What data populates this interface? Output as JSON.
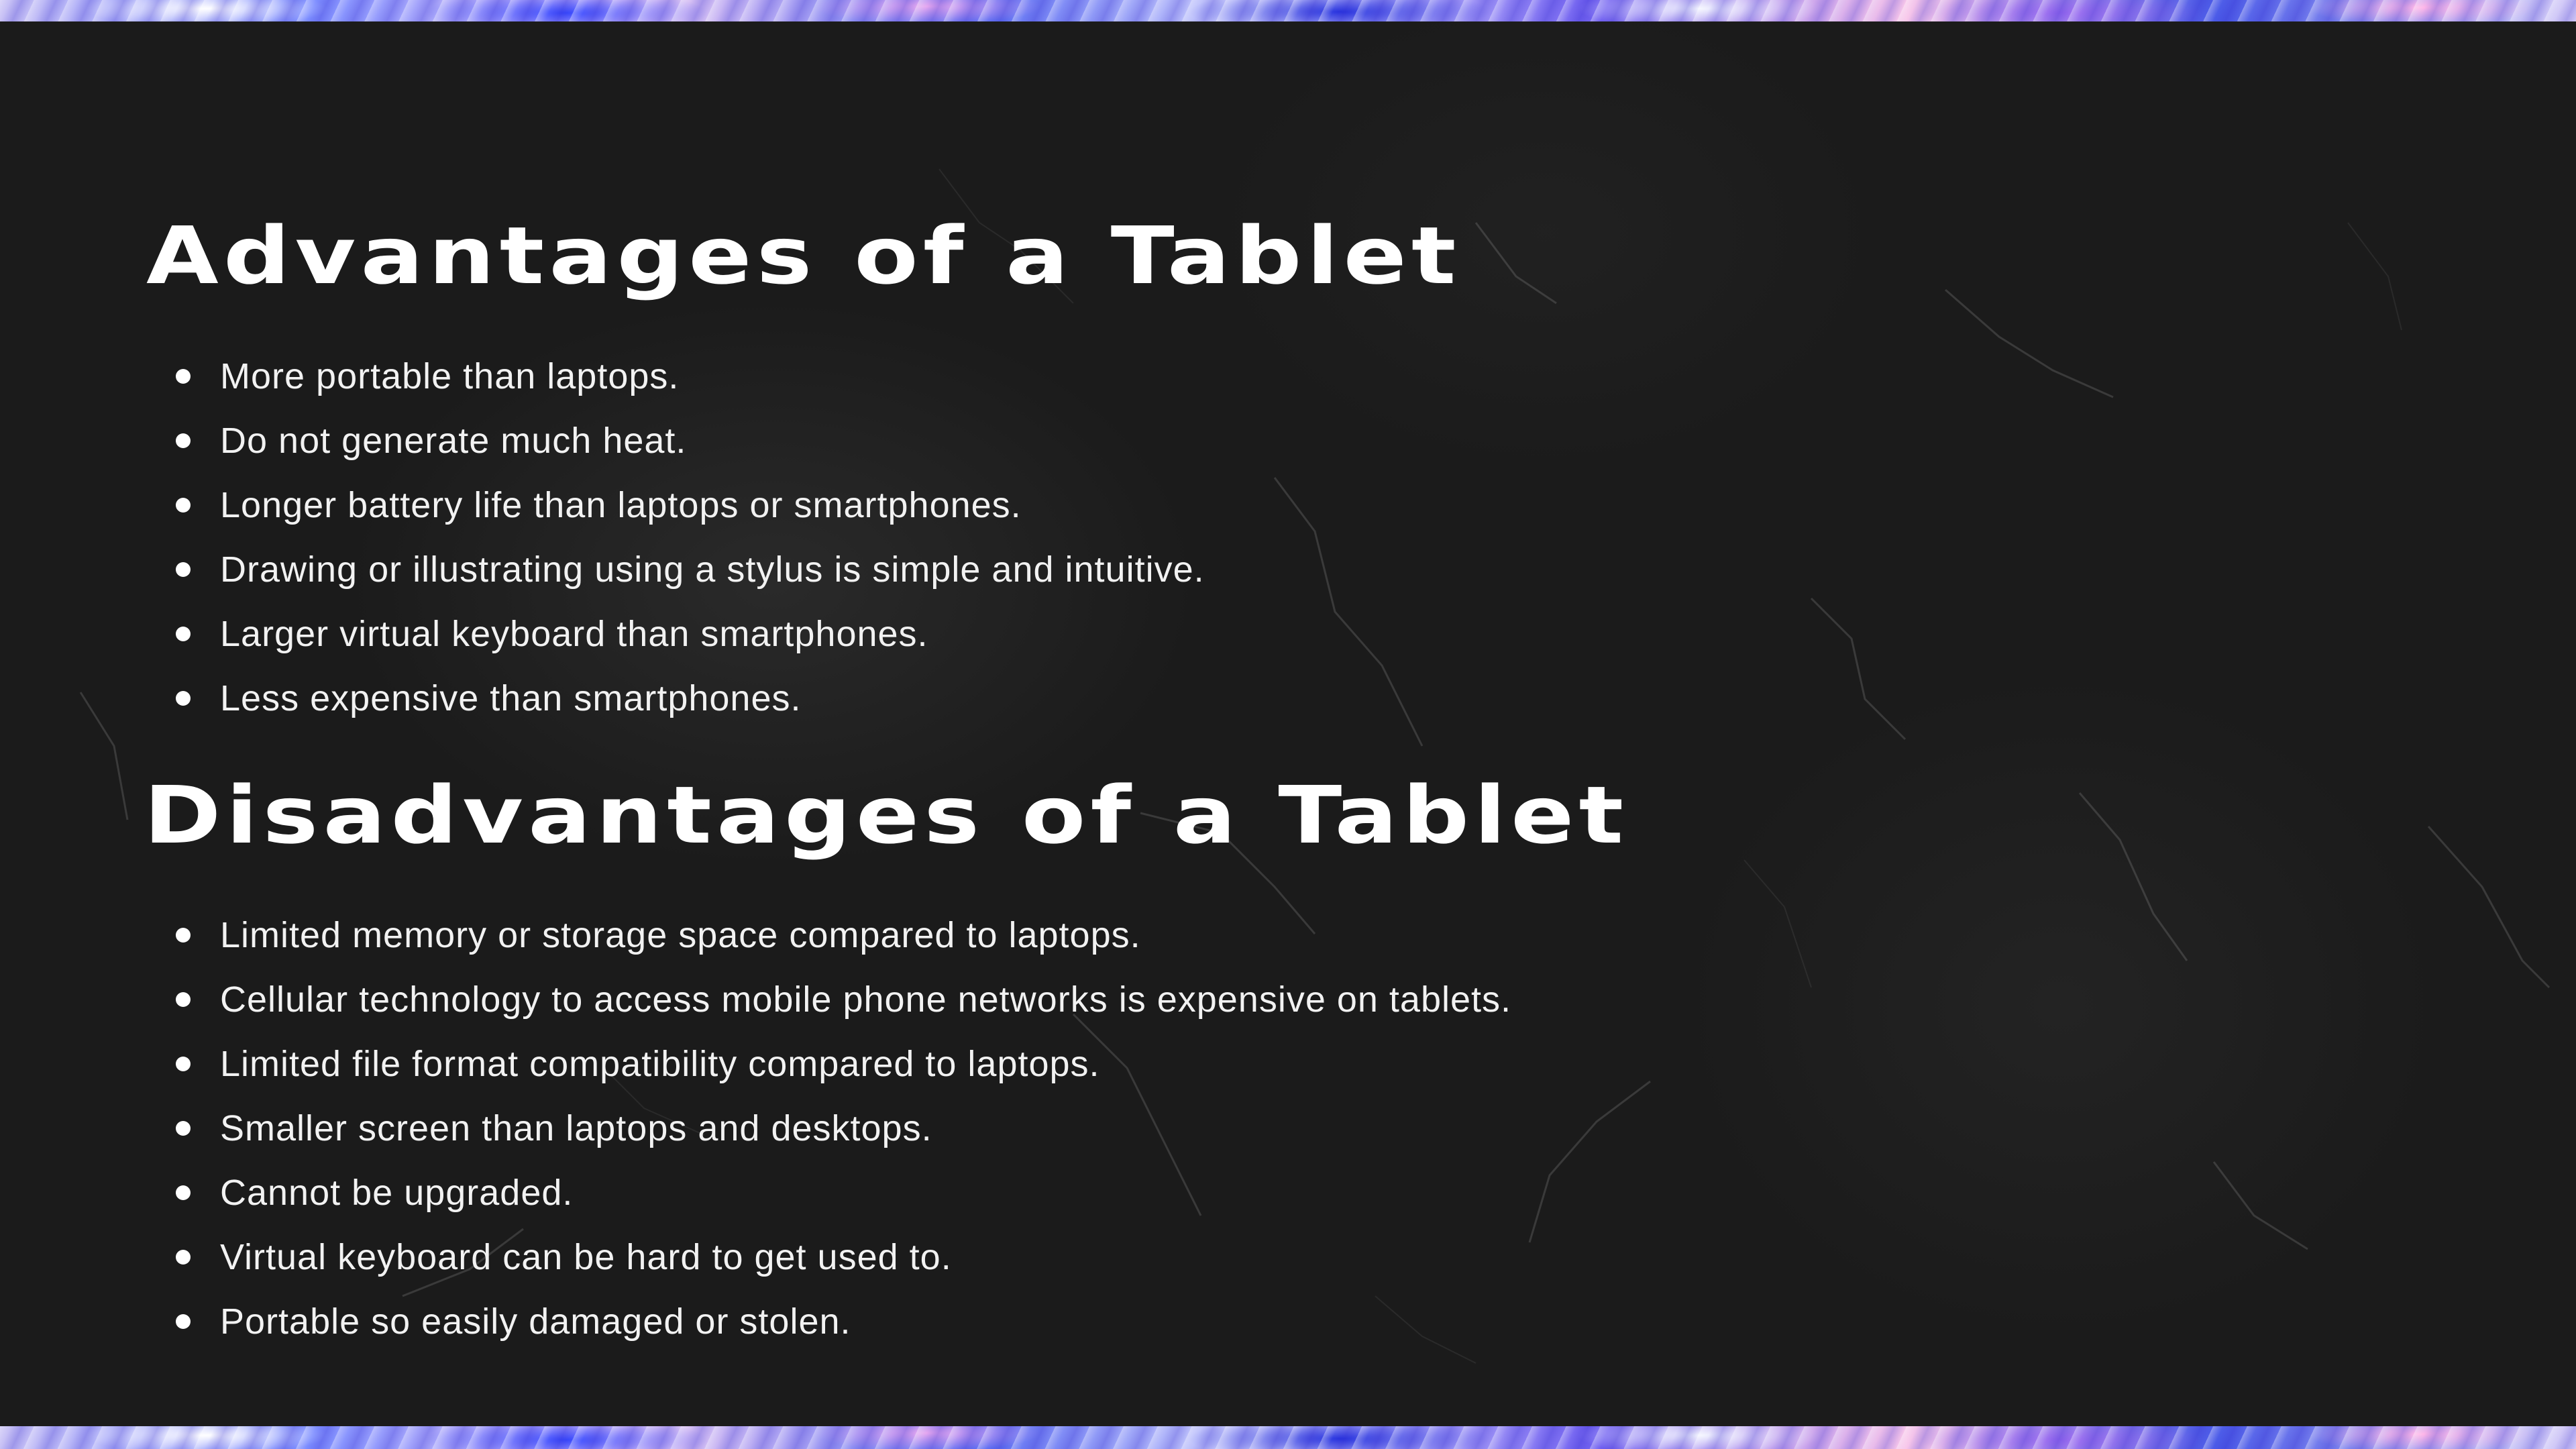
{
  "slide": {
    "advantages": {
      "title": "Advantages of a Tablet",
      "items": [
        "More portable than laptops.",
        "Do not generate much heat.",
        "Longer battery life than laptops or smartphones.",
        "Drawing or illustrating using a stylus is simple and intuitive.",
        "Larger virtual keyboard than smartphones.",
        "Less expensive than smartphones."
      ]
    },
    "disadvantages": {
      "title": "Disadvantages of a Tablet",
      "items": [
        "Limited memory or storage space compared to laptops.",
        "Cellular technology to access mobile phone networks is expensive on tablets.",
        "Limited file format compatibility compared to laptops.",
        "Smaller screen than laptops and desktops.",
        "Cannot be upgraded.",
        "Virtual keyboard can be hard to get used to.",
        "Portable so easily damaged or stolen."
      ]
    }
  },
  "colors": {
    "background": "#1b1b1b",
    "text": "#ffffff",
    "band_accent_blue": "#3a4bff",
    "band_accent_pink": "#f4d4f4"
  }
}
